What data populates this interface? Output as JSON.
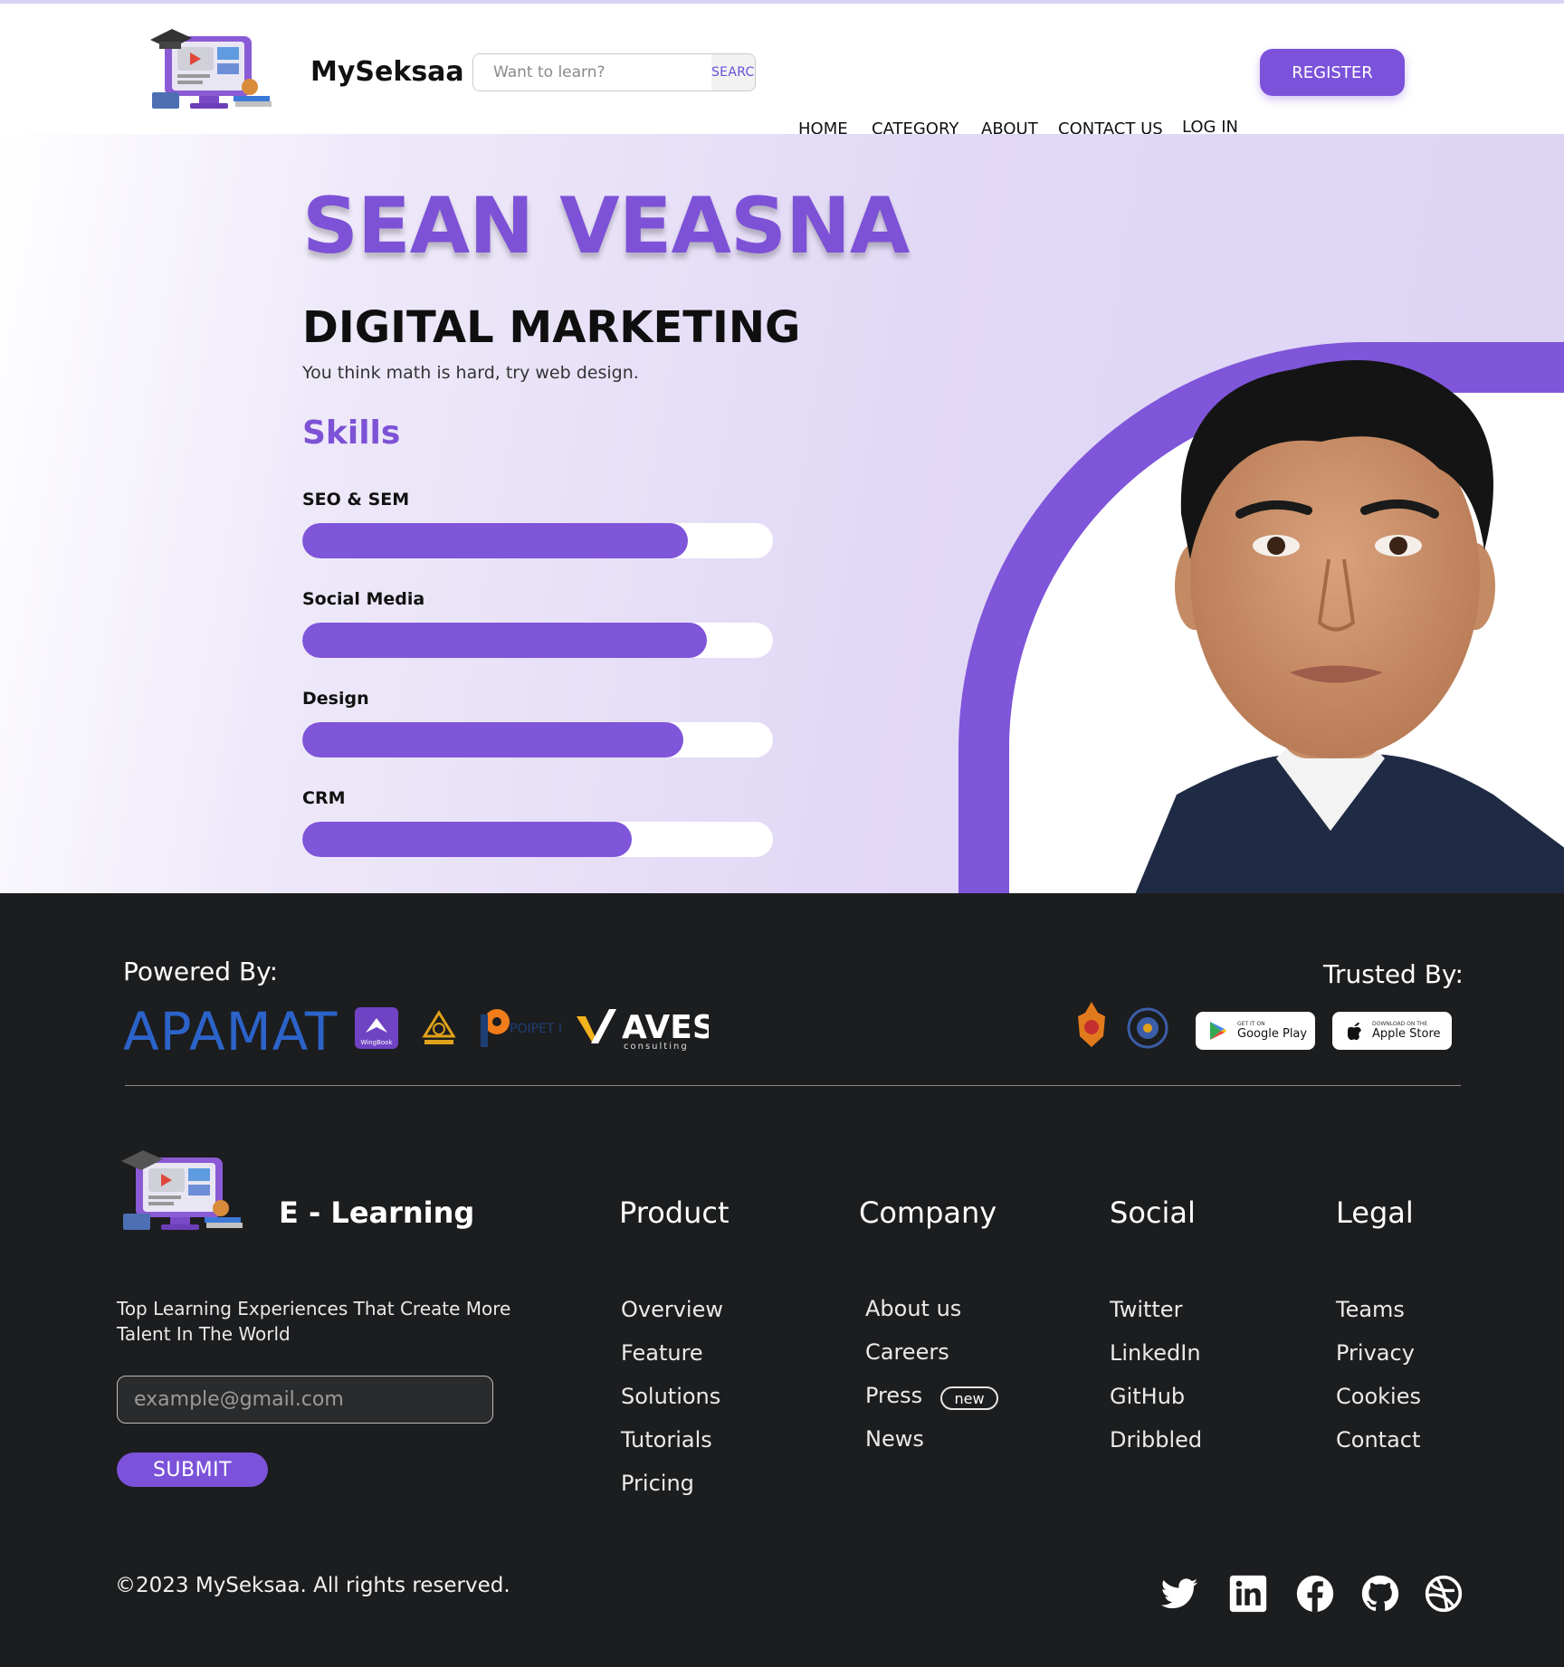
{
  "header": {
    "brand": "MySeksaa",
    "search_placeholder": "Want to learn?",
    "search_button": "SEARCH",
    "nav": [
      "HOME",
      "CATEGORY",
      "ABOUT",
      "CONTACT US",
      "LOG IN"
    ],
    "register": "REGISTER"
  },
  "hero": {
    "name": "SEAN VEASNA",
    "role": "DIGITAL MARKETING",
    "tagline": "You think math is hard, try web design.",
    "skills_title": "Skills",
    "skills": [
      {
        "label": "SEO & SEM",
        "level": 0.82
      },
      {
        "label": "Social Media",
        "level": 0.86
      },
      {
        "label": "Design",
        "level": 0.81
      },
      {
        "label": "CRM",
        "level": 0.7
      }
    ]
  },
  "partners": {
    "powered_label": "Powered By:",
    "trusted_label": "Trusted By:",
    "powered_logos": [
      "APAMAT",
      "WingBook",
      "Poipet Insider",
      "AVES consulting"
    ],
    "apamat_text": "APAMAT",
    "wingbook_text": "WingBook",
    "poipet_text": "POIPET Insider",
    "aves_text": "AVES",
    "aves_sub": "consulting",
    "google_small": "GET IT ON",
    "google_big": "Google Play",
    "apple_small": "DOWNLOAD ON THE",
    "apple_big": "Apple Store"
  },
  "footer": {
    "title": "E - Learning",
    "description": "Top Learning Experiences That Create More Talent In The World",
    "email_placeholder": "example@gmail.com",
    "submit": "SUBMIT",
    "columns": [
      {
        "heading": "Product",
        "items": [
          "Overview",
          "Feature",
          "Solutions",
          "Tutorials",
          "Pricing"
        ]
      },
      {
        "heading": "Company",
        "items": [
          "About us",
          "Careers",
          "Press",
          "News"
        ]
      },
      {
        "heading": "Social",
        "items": [
          "Twitter",
          "LinkedIn",
          "GitHub",
          "Dribbled"
        ]
      },
      {
        "heading": "Legal",
        "items": [
          "Teams",
          "Privacy",
          "Cookies",
          "Contact"
        ]
      }
    ],
    "press_badge": "new",
    "copyright": "©2023 MySeksaa. All rights reserved.",
    "social_icons": [
      "twitter-icon",
      "linkedin-icon",
      "facebook-icon",
      "github-icon",
      "dribbble-icon"
    ]
  },
  "colors": {
    "accent": "#7b52d9",
    "footer_bg": "#1c1d1f",
    "hero_bg": "#e2d9f6"
  }
}
